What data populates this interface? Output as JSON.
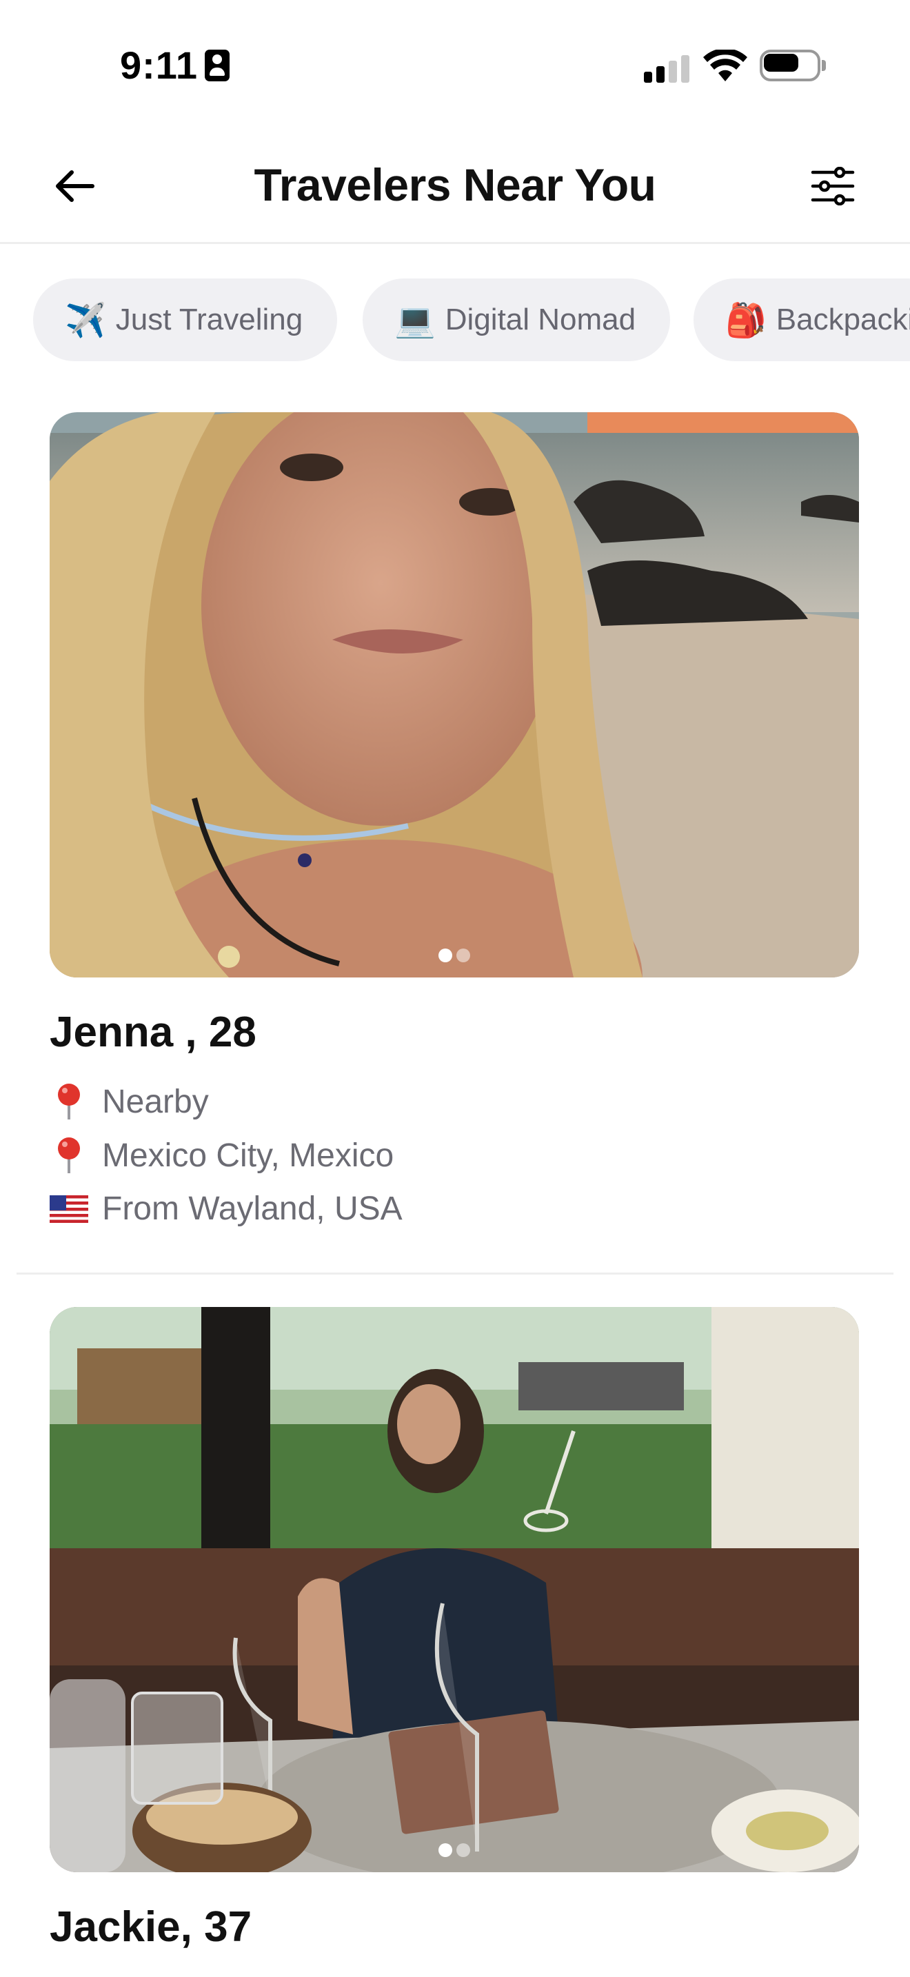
{
  "status_bar": {
    "time": "9:11"
  },
  "header": {
    "title": "Travelers Near You"
  },
  "chips": [
    {
      "emoji": "✈️",
      "label": "Just Traveling"
    },
    {
      "emoji": "💻",
      "label": "Digital Nomad"
    },
    {
      "emoji": "🎒",
      "label": "Backpacki"
    }
  ],
  "profiles": [
    {
      "name": "Jenna , 28",
      "nearby": "Nearby",
      "location": "Mexico City, Mexico",
      "from": "From Wayland, USA",
      "photo_count": 2,
      "active_photo": 1
    },
    {
      "name": "Jackie, 37",
      "photo_count": 2,
      "active_photo": 1
    }
  ],
  "colors": {
    "accent_pin": "#e0342c",
    "chip_bg": "#f0f0f3",
    "secondary_text": "#6b6b73"
  }
}
